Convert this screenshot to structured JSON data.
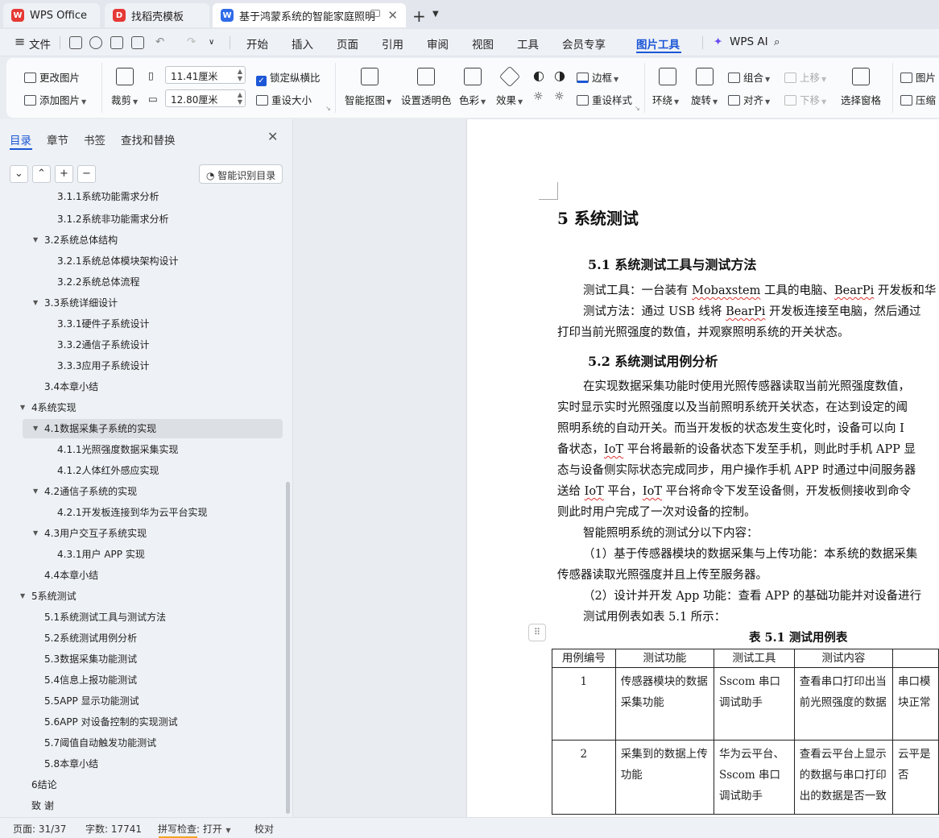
{
  "tabs": {
    "wps": "WPS Office",
    "daoke": "找稻壳模板",
    "doc": "基于鸿蒙系统的智能家庭照明"
  },
  "menu": {
    "file": "文件",
    "items": [
      "开始",
      "插入",
      "页面",
      "引用",
      "审阅",
      "视图",
      "工具",
      "会员专享",
      "图片工具"
    ],
    "wps_ai": "WPS AI"
  },
  "ribbon": {
    "change_image": "更改图片",
    "add_image": "添加图片",
    "crop": "裁剪",
    "width_value": "11.41厘米",
    "height_value": "12.80厘米",
    "lock_ratio": "锁定纵横比",
    "reset_size": "重设大小",
    "smart_cutout": "智能抠图",
    "set_transparent": "设置透明色",
    "color": "色彩",
    "effects": "效果",
    "border": "边框",
    "reset_style": "重设样式",
    "wrap": "环绕",
    "rotate": "旋转",
    "group": "组合",
    "align": "对齐",
    "move_up": "上移",
    "move_down": "下移",
    "selection_pane": "选择窗格",
    "image_more": "图片",
    "compress": "压缩"
  },
  "nav": {
    "tabs": [
      "目录",
      "章节",
      "书签",
      "查找和替换"
    ],
    "ai_toc": "智能识别目录",
    "toc": [
      "3.1.1系统功能需求分析",
      "3.1.2系统非功能需求分析",
      "3.2系统总体结构",
      "3.2.1系统总体模块架构设计",
      "3.2.2系统总体流程",
      "3.3系统详细设计",
      "3.3.1硬件子系统设计",
      "3.3.2通信子系统设计",
      "3.3.3应用子系统设计",
      "3.4本章小结",
      "4系统实现",
      "4.1数据采集子系统的实现",
      "4.1.1光照强度数据采集实现",
      "4.1.2人体红外感应实现",
      "4.2通信子系统的实现",
      "4.2.1开发板连接到华为云平台实现",
      "4.3用户交互子系统实现",
      "4.3.1用户 APP 实现",
      "4.4本章小结",
      "5系统测试",
      "5.1系统测试工具与测试方法",
      "5.2系统测试用例分析",
      "5.3数据采集功能测试",
      "5.4信息上报功能测试",
      "5.5APP 显示功能测试",
      "5.6APP 对设备控制的实现测试",
      "5.7阈值自动触发功能测试",
      "5.8本章小结",
      "6结论",
      "致  谢"
    ]
  },
  "doc": {
    "h1": "5  系统测试",
    "h2_1": "5.1  系统测试工具与测试方法",
    "p1a": "测试工具：一台装有 ",
    "p1b": "Mobaxstem",
    "p1c": " 工具的电脑、",
    "p1d": "BearPi",
    "p1e": " 开发板和华",
    "p2a": "测试方法：通过 USB 线将 ",
    "p2b": "BearPi",
    "p2c": " 开发板连接至电脑，然后通过",
    "p3": "打印当前光照强度的数值，并观察照明系统的开关状态。",
    "h2_2": "5.2  系统测试用例分析",
    "p4": "在实现数据采集功能时使用光照传感器读取当前光照强度数值，",
    "p5": "实时显示实时光照强度以及当前照明系统开关状态，在达到设定的阈",
    "p6": "照明系统的自动开关。而当开发板的状态发生变化时，设备可以向 I",
    "p7a": "备状态，",
    "p7b": "IoT",
    "p7c": " 平台将最新的设备状态下发至手机，则此时手机 APP 显",
    "p8": "态与设备侧实际状态完成同步，用户操作手机 APP 时通过中间服务器",
    "p9a": "送给 ",
    "p9b": "IoT",
    "p9c": " 平台，",
    "p9d": "IoT",
    "p9e": " 平台将命令下发至设备侧，开发板侧接收到命令",
    "p10": "则此时用户完成了一次对设备的控制。",
    "p11": "智能照明系统的测试分以下内容：",
    "p12": "（1）基于传感器模块的数据采集与上传功能：本系统的数据采集",
    "p13": "传感器读取光照强度并且上传至服务器。",
    "p14": "（2）设计并开发 App 功能：查看 APP 的基础功能并对设备进行",
    "p15": "测试用例表如表 5.1 所示：",
    "table_caption": "表 5.1  测试用例表",
    "table": {
      "headers": [
        "用例编号",
        "测试功能",
        "测试工具",
        "测试内容",
        ""
      ],
      "rows": [
        [
          "1",
          "传感器模块的数据采集功能",
          "Sscom 串口调试助手",
          "查看串口打印出当前光照强度的数据",
          "串口模块正常"
        ],
        [
          "2",
          "采集到的数据上传功能",
          "华为云平台、Sscom 串口调试助手",
          "查看云平台上显示的数据与串口打印出的数据是否一致",
          "云平是否"
        ]
      ]
    }
  },
  "status": {
    "page": "页面: 31/37",
    "words": "字数: 17741",
    "spell": "拼写检查: 打开",
    "proof": "校对"
  }
}
